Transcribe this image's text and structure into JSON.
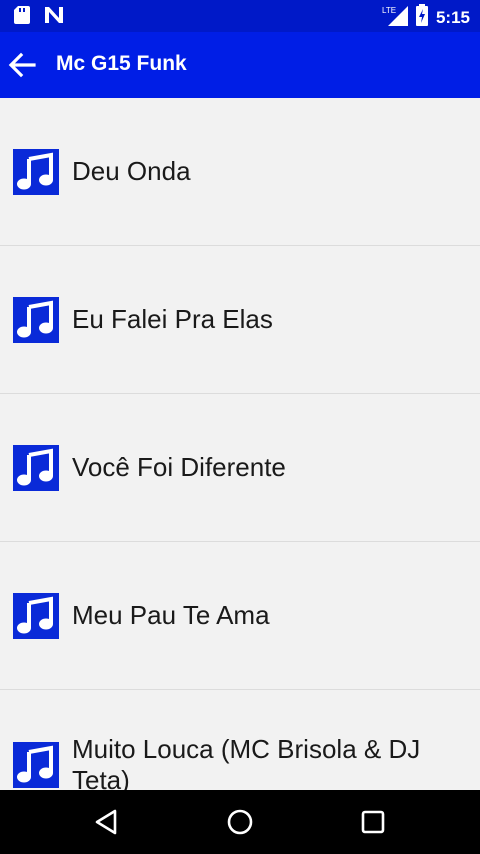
{
  "status_bar": {
    "time": "5:15",
    "network_label": "LTE",
    "left_icons": [
      "sd-card-icon",
      "n-logo-icon"
    ],
    "right_icons": [
      "lte-signal-icon",
      "battery-charging-icon"
    ]
  },
  "app_bar": {
    "title": "Mc G15 Funk",
    "back_icon": "arrow-back-icon"
  },
  "songs": [
    {
      "title": "Deu Onda",
      "icon": "music-note-icon"
    },
    {
      "title": "Eu Falei Pra Elas",
      "icon": "music-note-icon"
    },
    {
      "title": "Você Foi Diferente",
      "icon": "music-note-icon"
    },
    {
      "title": "Meu Pau Te Ama",
      "icon": "music-note-icon"
    },
    {
      "title": "Muito Louca (MC Brisola & DJ Teta)",
      "icon": "music-note-icon"
    }
  ],
  "nav_bar": {
    "buttons": [
      "back-triangle-icon",
      "home-circle-icon",
      "recents-square-icon"
    ]
  },
  "colors": {
    "status_bar": "#0019c8",
    "app_bar": "#001ee6",
    "icon_bg": "#0a2ad8",
    "list_bg": "#f2f2f2",
    "nav_bar": "#000000"
  }
}
